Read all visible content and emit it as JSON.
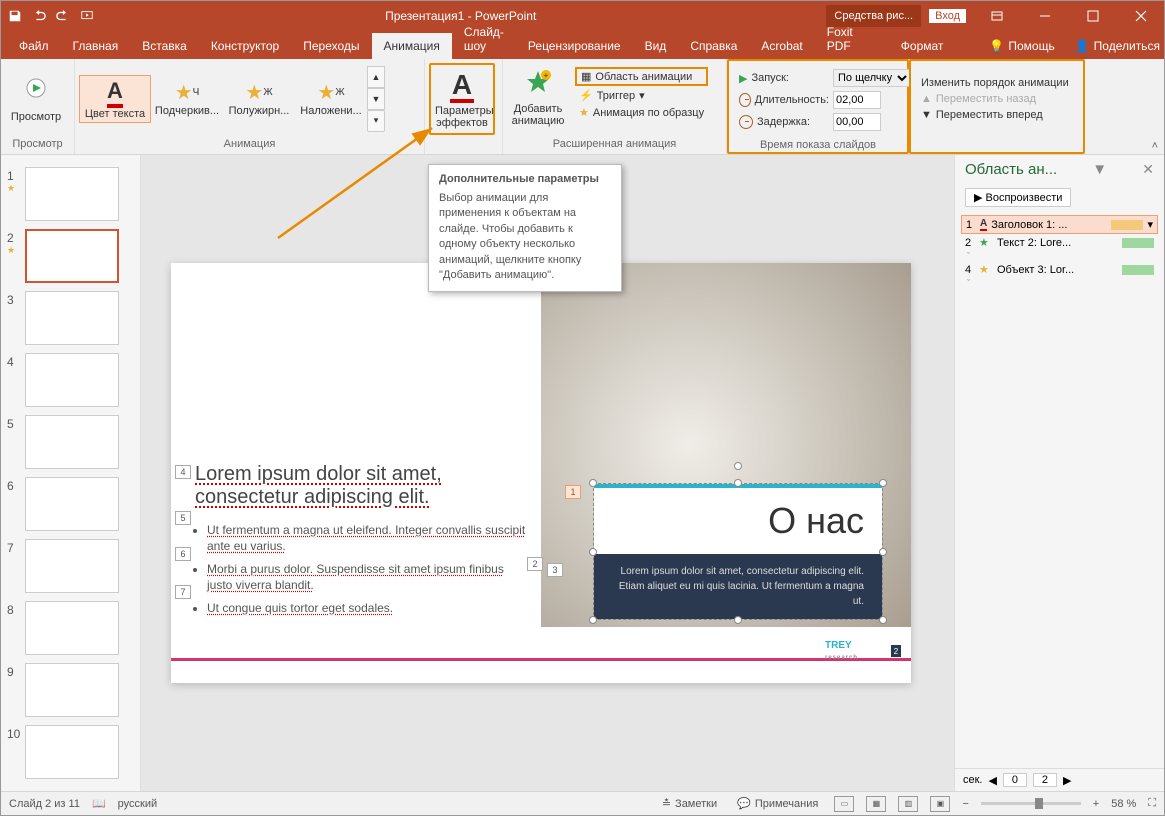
{
  "titlebar": {
    "title": "Презентация1 - PowerPoint",
    "contextual_tab": "Средства рис...",
    "login": "Вход"
  },
  "tabs": {
    "file": "Файл",
    "home": "Главная",
    "insert": "Вставка",
    "design": "Конструктор",
    "transitions": "Переходы",
    "animations": "Анимация",
    "slideshow": "Слайд-шоу",
    "review": "Рецензирование",
    "view": "Вид",
    "help": "Справка",
    "acrobat": "Acrobat",
    "foxit": "Foxit PDF",
    "format": "Формат",
    "assist": "Помощь",
    "share": "Поделиться"
  },
  "ribbon": {
    "preview": {
      "button": "Просмотр",
      "group": "Просмотр"
    },
    "gallery": {
      "items": [
        "Цвет текста",
        "Подчеркив...",
        "Полужирн...",
        "Наложени..."
      ],
      "group": "Анимация"
    },
    "params": {
      "button": "Параметры эффектов",
      "dropdown_marker": "▾"
    },
    "extended": {
      "add": "Добавить анимацию",
      "pane": "Область анимации",
      "trigger": "Триггер",
      "painter": "Анимация по образцу",
      "group": "Расширенная анимация"
    },
    "timing": {
      "start_label": "Запуск:",
      "start_value": "По щелчку",
      "duration_label": "Длительность:",
      "duration_value": "02,00",
      "delay_label": "Задержка:",
      "delay_value": "00,00",
      "group": "Время показа слайдов"
    },
    "reorder": {
      "title": "Изменить порядок анимации",
      "back": "Переместить назад",
      "forward": "Переместить вперед"
    }
  },
  "tooltip": {
    "title": "Дополнительные параметры",
    "body": "Выбор анимации для применения к объектам на слайде. Чтобы добавить к одному объекту несколько анимаций, щелкните кнопку \"Добавить анимацию\"."
  },
  "thumbnails": {
    "count": 10
  },
  "slide": {
    "left_title1": "Lorem ipsum dolor sit amet,",
    "left_title2": "consectetur adipiscing elit.",
    "bullets": [
      "Ut fermentum a magna ut eleifend. Integer convallis suscipit ante eu varius.",
      "Morbi a purus dolor. Suspendisse sit amet ipsum finibus justo viverra blandit.",
      "Ut congue quis tortor eget sodales."
    ],
    "title": "О нас",
    "subtitle": "Lorem ipsum dolor sit amet, consectetur adipiscing elit. Etiam aliquet eu mi quis lacinia. Ut fermentum a magna ut.",
    "brand": "TREY",
    "brand_sub": "research",
    "page_num": "2",
    "anim_tags": [
      "4",
      "5",
      "6",
      "7",
      "1",
      "2",
      "3"
    ]
  },
  "anim_pane": {
    "title": "Область ан...",
    "play": "Воспроизвести",
    "items": [
      {
        "idx": "1",
        "star_color": "#e8b23a",
        "label_prefix": "A",
        "label": "Заголовок 1: ...",
        "bar_color": "#f4c97a",
        "selected": true
      },
      {
        "idx": "2",
        "star_color": "#3aa655",
        "label_prefix": "",
        "label": "Текст 2: Lore...",
        "bar_color": "#9fd89f",
        "selected": false
      },
      {
        "idx": "4",
        "star_color": "#e8b23a",
        "label_prefix": "",
        "label": "Объект 3: Lor...",
        "bar_color": "#9fd89f",
        "selected": false
      }
    ],
    "footer": {
      "label": "сек.",
      "cur": "0",
      "total": "2"
    }
  },
  "statusbar": {
    "slide_info": "Слайд 2 из 11",
    "lang": "русский",
    "notes": "Заметки",
    "comments": "Примечания",
    "zoom": "58 %"
  }
}
